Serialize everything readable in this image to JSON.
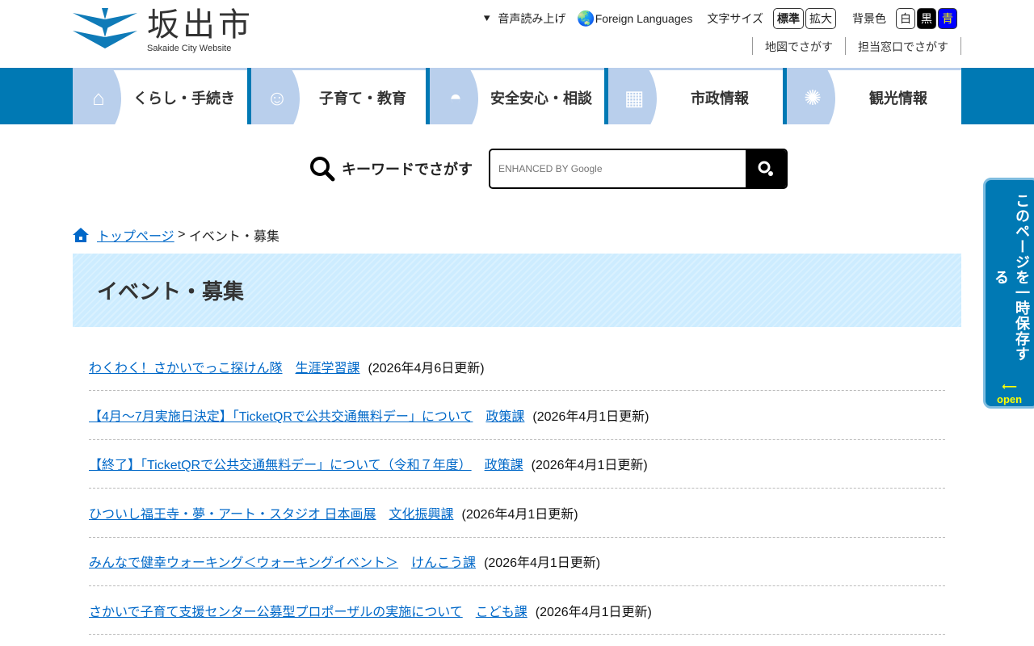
{
  "header": {
    "logo_jp": "坂出市",
    "logo_en": "Sakaide City Website",
    "utility": {
      "speech": "音声読み上げ",
      "foreign": "Foreign Languages",
      "font_size_label": "文字サイズ",
      "font_standard": "標準",
      "font_large": "拡大",
      "bg_label": "背景色",
      "bg_white": "白",
      "bg_black": "黒",
      "bg_blue": "青"
    },
    "links": [
      "地図でさがす",
      "担当窓口でさがす"
    ]
  },
  "nav": [
    {
      "label": "くらし・手続き",
      "icon": "house-icon"
    },
    {
      "label": "子育て・教育",
      "icon": "baby-icon"
    },
    {
      "label": "安全安心・相談",
      "icon": "helmet-icon"
    },
    {
      "label": "市政情報",
      "icon": "building-icon"
    },
    {
      "label": "観光情報",
      "icon": "firework-icon"
    }
  ],
  "search": {
    "label": "キーワードでさがす",
    "placeholder": "ENHANCED BY Google"
  },
  "breadcrumb": {
    "home": "トップページ",
    "sep": " > ",
    "current": "イベント・募集"
  },
  "page_title": "イベント・募集",
  "items": [
    {
      "title": "わくわく！さかいでっこ探けん隊",
      "dept": "生涯学習課",
      "date": "(2026年4月6日更新)"
    },
    {
      "title": "【4月～7月実施日決定】「TicketQRで公共交通無料デー」について",
      "dept": "政策課",
      "date": "(2026年4月1日更新)"
    },
    {
      "title": "【終了】「TicketQRで公共交通無料デー」について（令和７年度）",
      "dept": "政策課",
      "date": "(2026年4月1日更新)"
    },
    {
      "title": "ひついし福王寺・夢・アート・スタジオ 日本画展",
      "dept": "文化振興課",
      "date": "(2026年4月1日更新)"
    },
    {
      "title": "みんなで健幸ウォーキング＜ウォーキングイベント＞",
      "dept": "けんこう課",
      "date": "(2026年4月1日更新)"
    },
    {
      "title": "さかいで子育て支援センター公募型プロポーザルの実施について",
      "dept": "こども課",
      "date": "(2026年4月1日更新)"
    }
  ],
  "side_tab": {
    "label": "このページを一時保存する",
    "open": "open"
  }
}
